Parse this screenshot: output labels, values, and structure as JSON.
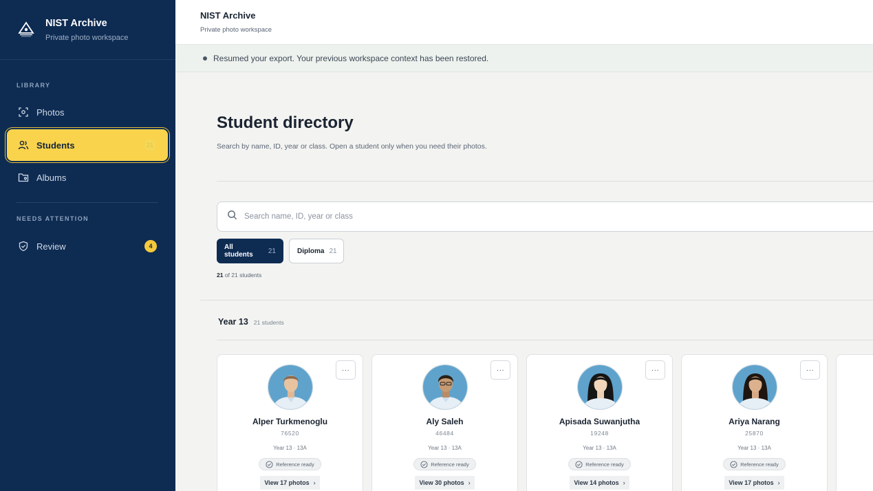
{
  "brand": {
    "title": "NIST Archive",
    "subtitle": "Private photo workspace"
  },
  "sidebar": {
    "library_label": "LIBRARY",
    "items": [
      {
        "label": "Photos",
        "icon": "photo-scan-icon"
      },
      {
        "label": "Students",
        "icon": "users-icon",
        "count": "21"
      },
      {
        "label": "Albums",
        "icon": "folder-heart-icon"
      }
    ],
    "attention_label": "NEEDS ATTENTION",
    "review": {
      "label": "Review",
      "icon": "shield-check-icon",
      "badge": "4"
    }
  },
  "topbar": {
    "title": "NIST Archive",
    "subtitle": "Private photo workspace"
  },
  "notice": {
    "text": "Resumed your export. Your previous workspace context has been restored."
  },
  "main": {
    "title": "Student directory",
    "description": "Search by name, ID, year or class. Open a student only when you need their photos.",
    "search_placeholder": "Search name, ID, year or class",
    "filters": [
      {
        "label": "All students",
        "count": "21"
      },
      {
        "label": "Diploma",
        "count": "21"
      }
    ],
    "result_shown": "21",
    "result_rest": "of 21 students",
    "group": {
      "title": "Year 13",
      "count": "21 students"
    }
  },
  "students": [
    {
      "name": "Alper Turkmenoglu",
      "id": "76520",
      "year_class": "Year 13 · 13A",
      "status": "Reference ready",
      "view": "View 17 photos",
      "more": "···"
    },
    {
      "name": "Aly Saleh",
      "id": "46484",
      "year_class": "Year 13 · 13A",
      "status": "Reference ready",
      "view": "View 30 photos",
      "more": "···"
    },
    {
      "name": "Apisada Suwanjutha",
      "id": "19248",
      "year_class": "Year 13 · 13A",
      "status": "Reference ready",
      "view": "View 14 photos",
      "more": "···"
    },
    {
      "name": "Ariya Narang",
      "id": "25870",
      "year_class": "Year 13 · 13A",
      "status": "Reference ready",
      "view": "View 17 photos",
      "more": "···"
    }
  ],
  "colors": {
    "sidebar": "#0e2b52",
    "accent": "#f9d34c",
    "primary_chip": "#0e2b52"
  }
}
